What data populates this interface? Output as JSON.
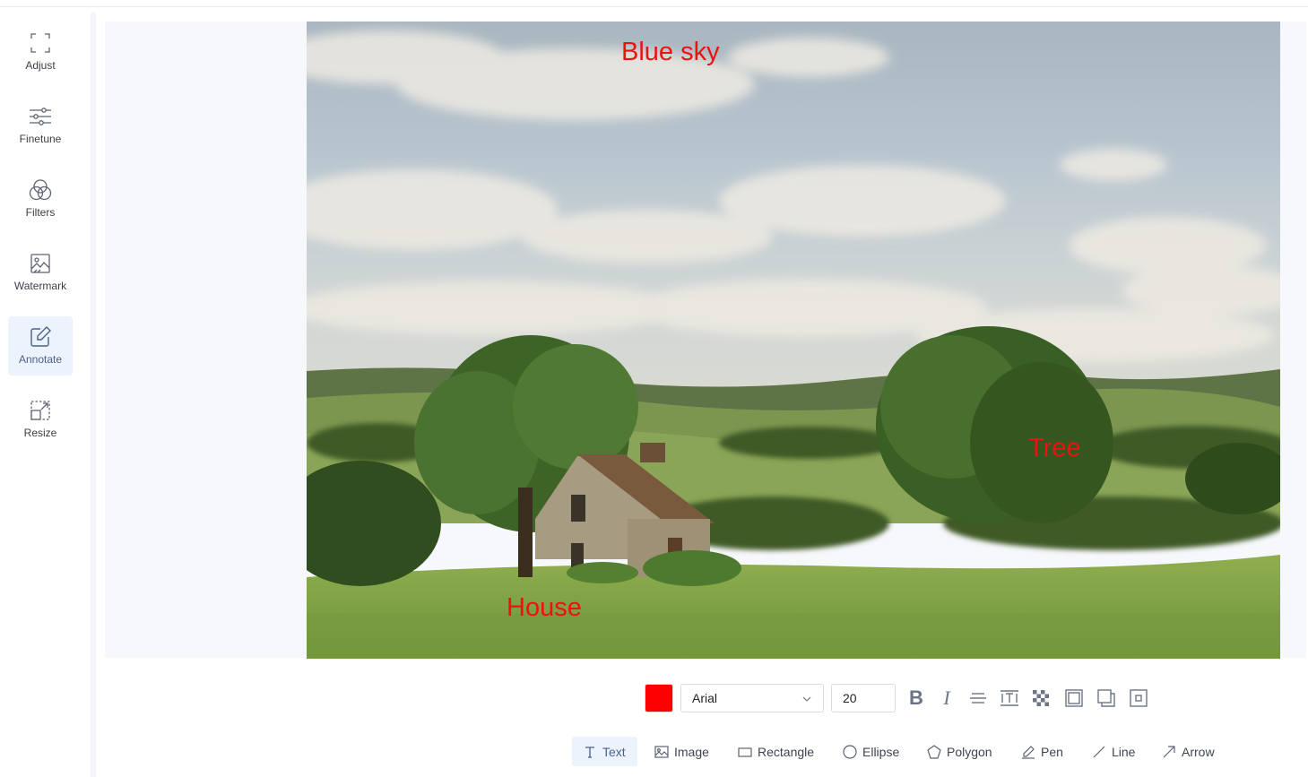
{
  "sidebar": {
    "items": [
      {
        "label": "Adjust",
        "icon": "crop-frame-icon"
      },
      {
        "label": "Finetune",
        "icon": "sliders-icon"
      },
      {
        "label": "Filters",
        "icon": "overlapping-circles-icon"
      },
      {
        "label": "Watermark",
        "icon": "image-mark-icon"
      },
      {
        "label": "Annotate",
        "icon": "pencil-square-icon",
        "active": true
      },
      {
        "label": "Resize",
        "icon": "resize-icon"
      }
    ]
  },
  "canvas": {
    "annotations": [
      {
        "text": "Blue sky"
      },
      {
        "text": "Tree"
      },
      {
        "text": "House"
      }
    ],
    "annotation_color": "#ee1111"
  },
  "text_toolbar": {
    "color": "#ff0000",
    "font_family": "Arial",
    "font_size": "20"
  },
  "tools": [
    {
      "label": "Text",
      "icon": "text-icon",
      "active": true
    },
    {
      "label": "Image",
      "icon": "image-icon"
    },
    {
      "label": "Rectangle",
      "icon": "rectangle-icon"
    },
    {
      "label": "Ellipse",
      "icon": "ellipse-icon"
    },
    {
      "label": "Polygon",
      "icon": "polygon-icon"
    },
    {
      "label": "Pen",
      "icon": "pen-icon"
    },
    {
      "label": "Line",
      "icon": "line-icon"
    },
    {
      "label": "Arrow",
      "icon": "arrow-icon"
    }
  ],
  "colors": {
    "accent": "#4a5f8e",
    "active_bg": "#edf3fd"
  }
}
